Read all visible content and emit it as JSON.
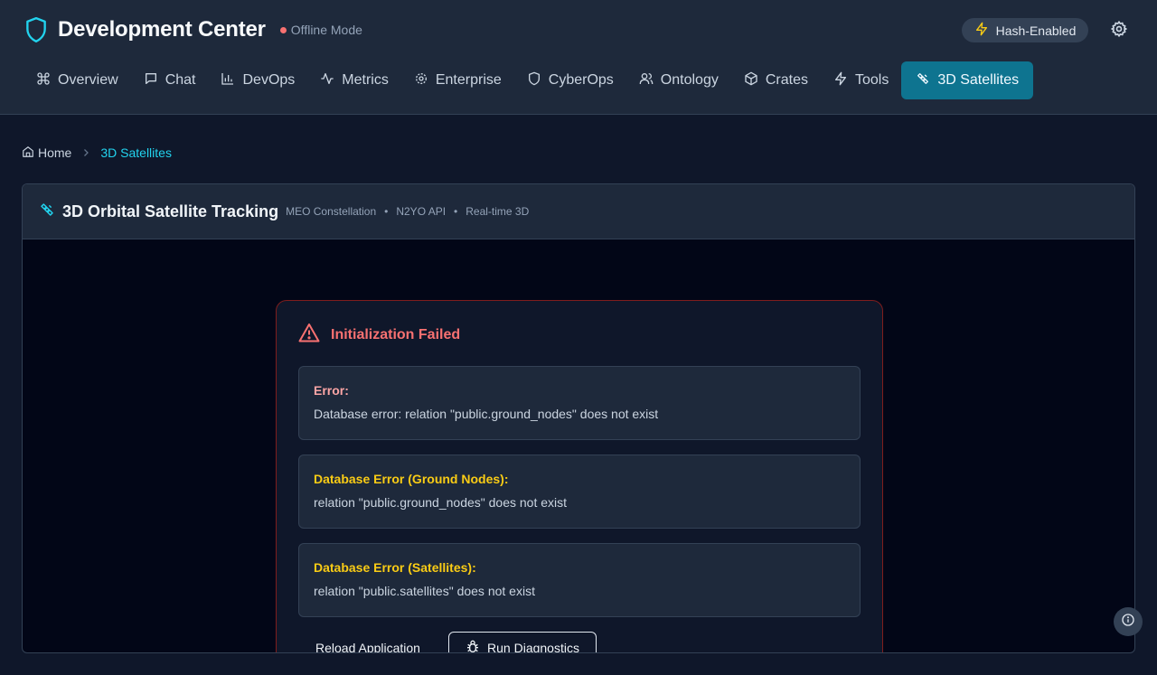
{
  "app": {
    "title": "Development Center",
    "status": "Offline Mode",
    "hash_badge": "Hash-Enabled"
  },
  "nav": {
    "items": [
      {
        "label": "Overview",
        "icon": "command-icon"
      },
      {
        "label": "Chat",
        "icon": "chat-icon"
      },
      {
        "label": "DevOps",
        "icon": "bar-chart-icon"
      },
      {
        "label": "Metrics",
        "icon": "activity-icon"
      },
      {
        "label": "Enterprise",
        "icon": "gear-icon"
      },
      {
        "label": "CyberOps",
        "icon": "shield-icon"
      },
      {
        "label": "Ontology",
        "icon": "users-icon"
      },
      {
        "label": "Crates",
        "icon": "box-icon"
      },
      {
        "label": "Tools",
        "icon": "bolt-icon"
      },
      {
        "label": "3D Satellites",
        "icon": "satellite-icon",
        "active": true
      }
    ]
  },
  "breadcrumb": {
    "home": "Home",
    "current": "3D Satellites"
  },
  "panel": {
    "title": "3D Orbital Satellite Tracking",
    "meta": [
      "MEO Constellation",
      "N2YO API",
      "Real-time 3D"
    ]
  },
  "error": {
    "title": "Initialization Failed",
    "boxes": [
      {
        "label": "Error:",
        "message": "Database error: relation \"public.ground_nodes\" does not exist"
      },
      {
        "label": "Database Error (Ground Nodes):",
        "message": "relation \"public.ground_nodes\" does not exist"
      },
      {
        "label": "Database Error (Satellites):",
        "message": "relation \"public.satellites\" does not exist"
      }
    ],
    "reload_label": "Reload Application",
    "diagnostics_label": "Run Diagnostics"
  },
  "colors": {
    "accent": "#0e7490",
    "error": "#f87171",
    "warning": "#facc15"
  }
}
